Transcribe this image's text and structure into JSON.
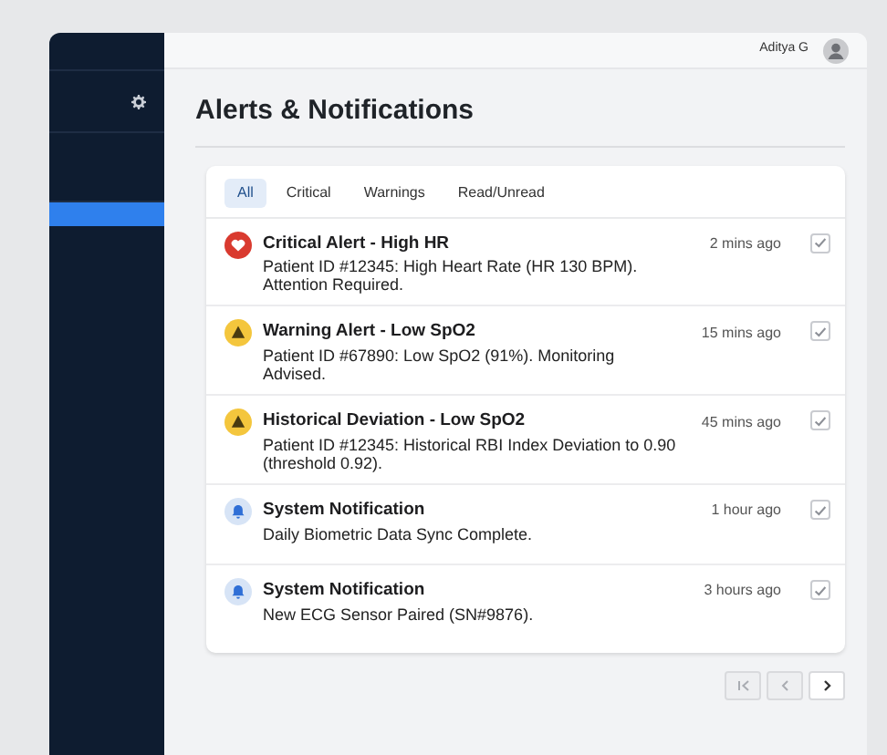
{
  "sidebar": {
    "items": [
      {
        "kind": "settings",
        "selected": false
      },
      {
        "kind": "blank",
        "selected": false
      },
      {
        "kind": "blank",
        "selected": true
      }
    ]
  },
  "header": {
    "user_name": "Aditya G"
  },
  "page_title": "Alerts & Notifications",
  "tabs": [
    {
      "label": "All",
      "selected": true
    },
    {
      "label": "Critical",
      "selected": false
    },
    {
      "label": "Warnings",
      "selected": false
    },
    {
      "label": "Read/Unread",
      "selected": false
    }
  ],
  "alerts": [
    {
      "kind": "critical",
      "title": "Critical Alert - High HR",
      "time": "2 mins ago",
      "message": "Patient ID #12345: High Heart Rate (HR 130 BPM). Attention Required.",
      "checked": true
    },
    {
      "kind": "warning",
      "title": "Warning Alert - Low SpO2",
      "time": "15 mins ago",
      "message": "Patient ID #67890: Low SpO2 (91%). Monitoring Advised.",
      "checked": true
    },
    {
      "kind": "warning",
      "title": "Historical Deviation - Low SpO2",
      "time": "45 mins ago",
      "message": "Patient ID #12345: Historical RBI Index Deviation to 0.90 (threshold 0.92).",
      "checked": true
    },
    {
      "kind": "system",
      "title": "System Notification",
      "time": "1 hour ago",
      "message": "Daily Biometric Data Sync Complete.",
      "checked": true
    },
    {
      "kind": "system",
      "title": "System Notification",
      "time": "3 hours ago",
      "message": "New ECG Sensor Paired (SN#9876).",
      "checked": true
    }
  ],
  "pagination": [
    {
      "kind": "first",
      "disabled": true
    },
    {
      "kind": "previous",
      "disabled": true
    },
    {
      "kind": "next",
      "disabled": false
    }
  ]
}
